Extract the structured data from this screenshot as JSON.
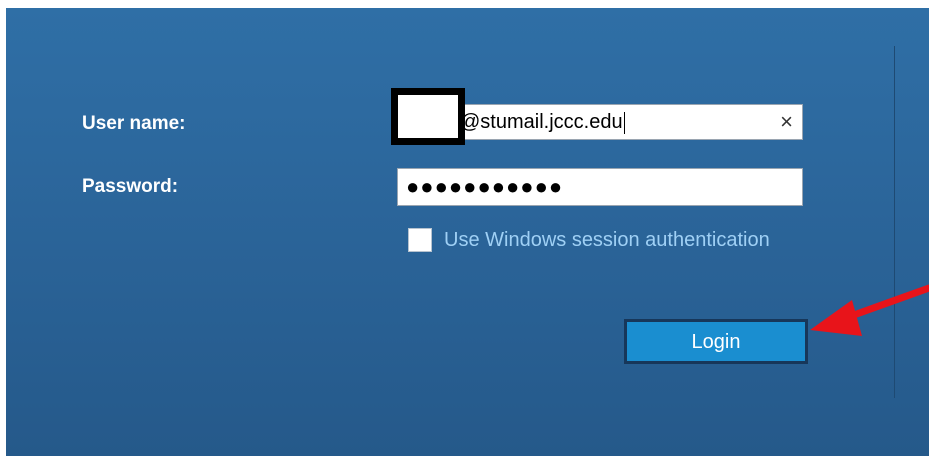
{
  "login_form": {
    "username_label": "User name:",
    "username_value": "@stumail.jccc.edu",
    "password_label": "Password:",
    "password_value": "●●●●●●●●●●●",
    "windows_auth_label": "Use Windows session authentication",
    "windows_auth_checked": false,
    "login_label": "Login",
    "clear_symbol": "×"
  },
  "icons": {
    "clear": "close-icon",
    "annotation": "red-arrow-icon"
  },
  "colors": {
    "panel_top": "#2f6fa6",
    "panel_bottom": "#25598a",
    "label_text": "#ffffff",
    "link_text": "#9fd0f5",
    "button_fill": "#1a8ed0",
    "button_border": "#17375a",
    "annotation_arrow": "#e8141a"
  }
}
